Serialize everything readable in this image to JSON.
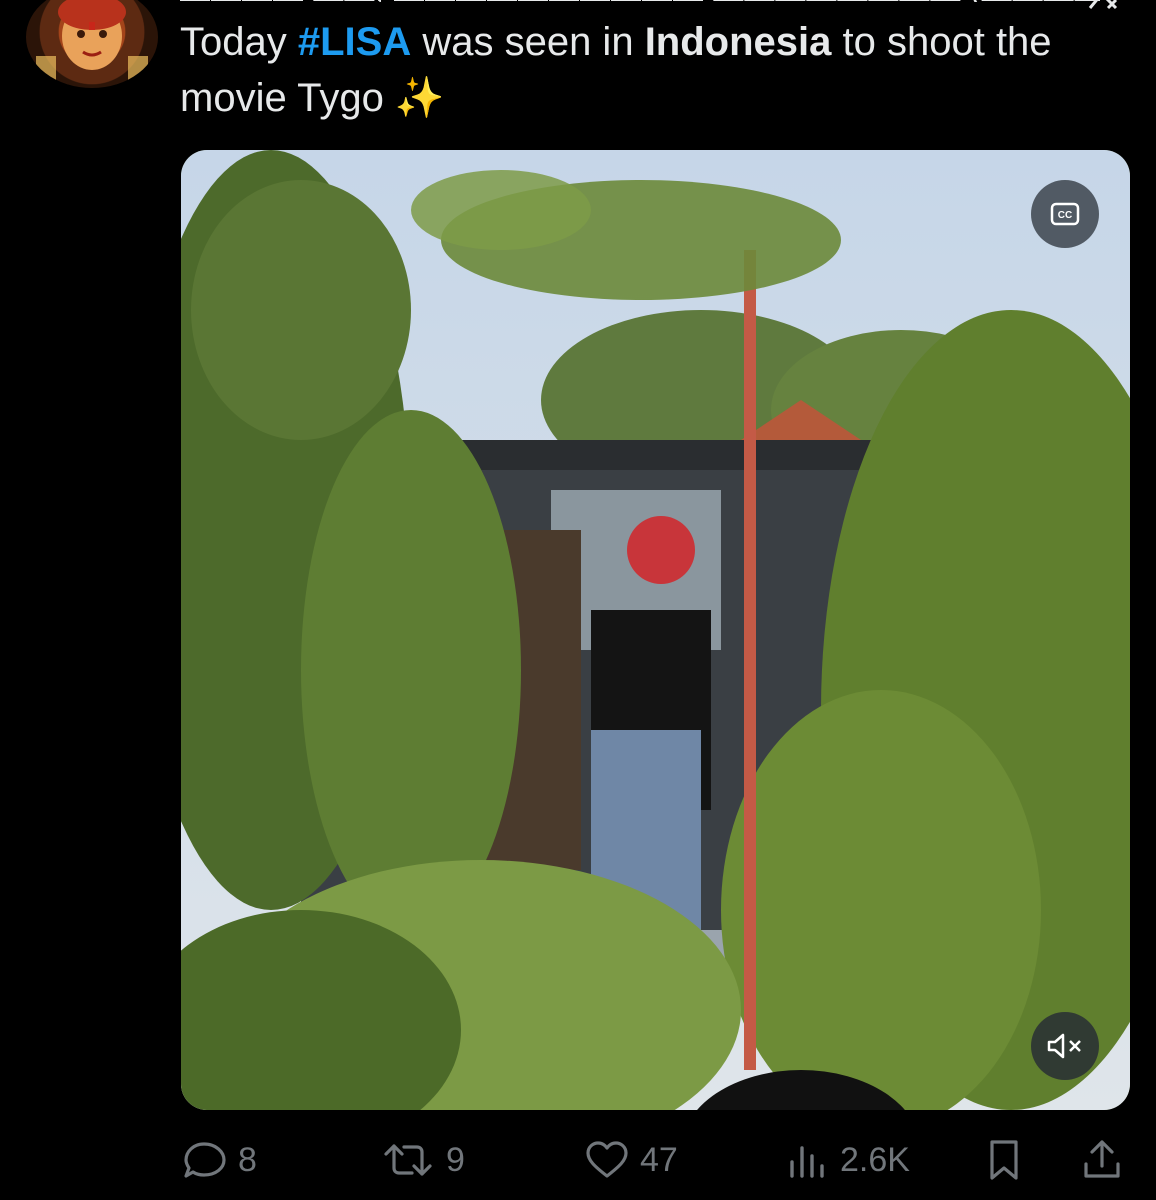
{
  "tweet": {
    "text_parts": {
      "p1": "Today ",
      "hashtag": "#LISA",
      "p2": " was seen in ",
      "place": "Indonesia",
      "p3": " to shoot the movie Tygo ",
      "emoji": "✨"
    }
  },
  "media": {
    "cc_icon": "closed-captions-icon",
    "mute_icon": "volume-muted-icon"
  },
  "actions": {
    "replies": "8",
    "reposts": "9",
    "likes": "47",
    "views": "2.6K"
  },
  "colors": {
    "background": "#000000",
    "text": "#e7e9ea",
    "hashtag": "#1d9bf0",
    "muted": "#71767b"
  }
}
